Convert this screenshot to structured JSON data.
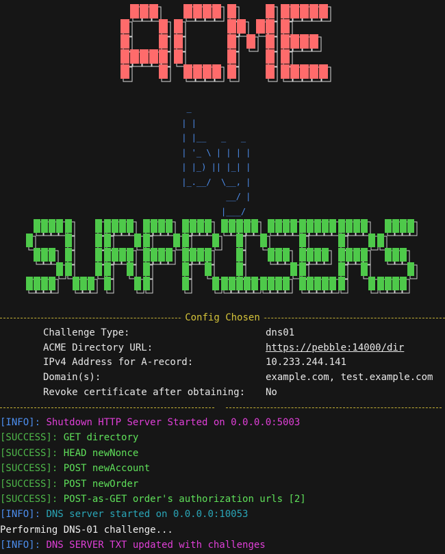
{
  "banner": {
    "title_art": "ACME",
    "by_art": "  _\n | |\n | |__   _   _\n | '_ \\ | | | |\n | |_) || |_| |\n |_.__/  \\__, |\n          __/ |\n         |___/",
    "author_art": "SURPRISERS",
    "colors": {
      "title": "#ff6b6b",
      "by": "#4d8ff0",
      "author": "#4ec94a"
    }
  },
  "config": {
    "title": "Config Chosen",
    "rows": [
      {
        "label": "Challenge Type:",
        "value": "dns01"
      },
      {
        "label": "ACME Directory URL:",
        "value": "https://pebble:14000/dir",
        "link": true
      },
      {
        "label": "IPv4 Address for A-record:",
        "value": "10.233.244.141"
      },
      {
        "label": "Domain(s):",
        "value": "example.com, test.example.com"
      },
      {
        "label": "Revoke certificate after obtaining:",
        "value": "No"
      }
    ]
  },
  "logs": [
    {
      "tag": "[INFO]:",
      "kind": "info",
      "message": " Shutdown HTTP Server Started on 0.0.0.0:5003",
      "color": "magenta"
    },
    {
      "tag": "[SUCCESS]:",
      "kind": "success",
      "message": " GET directory",
      "color": "green"
    },
    {
      "tag": "[SUCCESS]:",
      "kind": "success",
      "message": " HEAD newNonce",
      "color": "green"
    },
    {
      "tag": "[SUCCESS]:",
      "kind": "success",
      "message": " POST newAccount",
      "color": "green"
    },
    {
      "tag": "[SUCCESS]:",
      "kind": "success",
      "message": " POST newOrder",
      "color": "green"
    },
    {
      "tag": "[SUCCESS]:",
      "kind": "success",
      "message": " POST-as-GET order's authorization urls [2]",
      "color": "green"
    },
    {
      "tag": "[INFO]:",
      "kind": "info",
      "message": " DNS server started on 0.0.0.0:10053",
      "color": "cyan"
    },
    {
      "tag": "",
      "kind": "plain",
      "message": "Performing DNS-01 challenge...",
      "color": "white"
    },
    {
      "tag": "[INFO]:",
      "kind": "info",
      "message": " DNS SERVER TXT updated with challenges",
      "color": "magenta"
    }
  ]
}
